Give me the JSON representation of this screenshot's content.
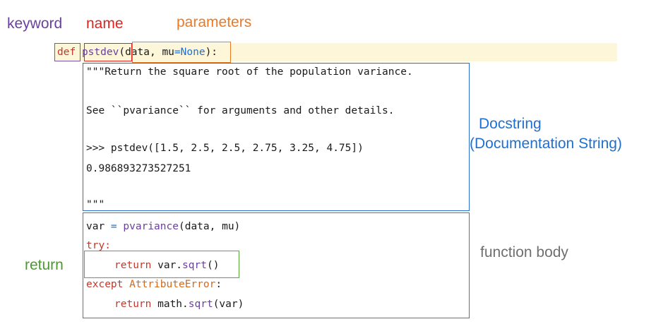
{
  "labels": {
    "keyword": "keyword",
    "name": "name",
    "parameters": "parameters",
    "docstring_line1": "Docstring",
    "docstring_line2": "(Documentation String)",
    "function_body": "function body",
    "return": "return"
  },
  "colors": {
    "keyword": "#6b3fa0",
    "name": "#e0231d",
    "parameters": "#ea7a26",
    "docstring": "#1f6fd1",
    "function_body": "#6f6f6f",
    "return": "#4b9a2e",
    "signature_highlight": "#fdf6d8"
  },
  "code": {
    "def_kw": "def",
    "func_name": "pstdev",
    "open_paren": "(",
    "param_data": "data, ",
    "param_mu": "mu",
    "equals": "=",
    "none_kw": "None",
    "close_paren_colon": "):",
    "doc_line1": "\"\"\"Return the square root of the population variance.",
    "doc_line2": "See ``pvariance`` for arguments and other details.",
    "doc_line3": ">>> pstdev([1.5, 2.5, 2.5, 2.75, 3.25, 4.75])",
    "doc_line4": "0.986893273527251",
    "doc_line5": "\"\"\"",
    "body_var": "var",
    "body_eq": " = ",
    "body_pvariance": "pvariance",
    "body_args": "(data, mu)",
    "body_try": "try:",
    "ret1_kw": "return",
    "ret1_var": " var.",
    "ret1_sqrt": "sqrt",
    "ret1_paren": "()",
    "except_kw": "except",
    "except_err": " AttributeError",
    "except_colon": ":",
    "ret2_kw": "return",
    "ret2_math": " math.",
    "ret2_sqrt": "sqrt",
    "ret2_args": "(var)"
  }
}
